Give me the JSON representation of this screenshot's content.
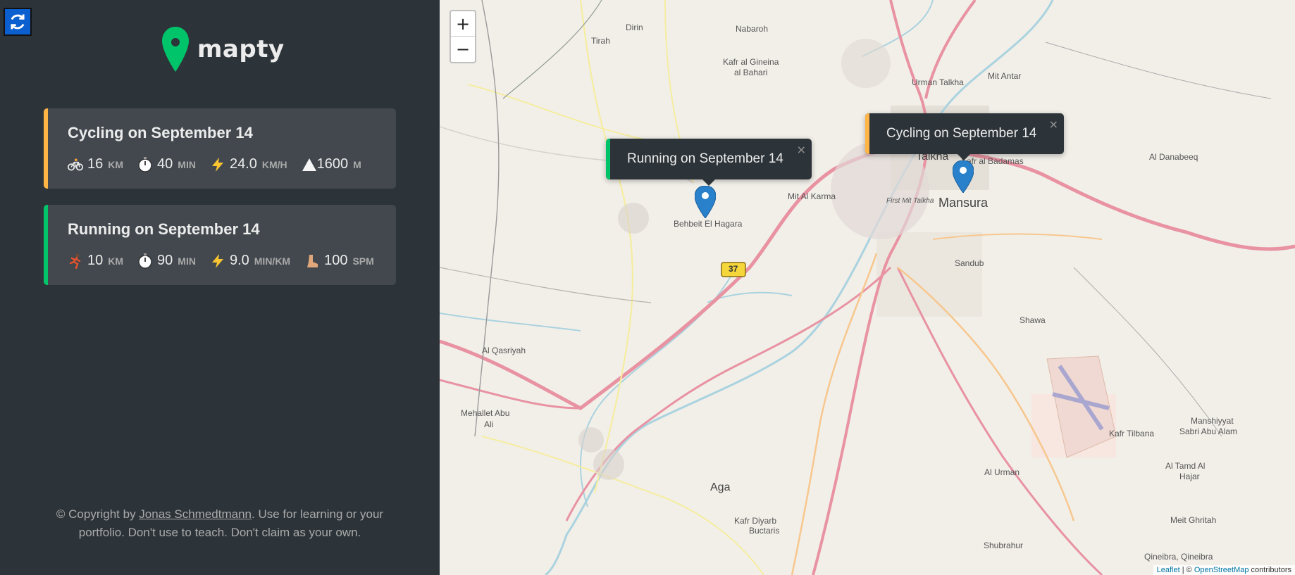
{
  "app": {
    "title": "mapty"
  },
  "colors": {
    "cycling": "#ffb545",
    "running": "#00c46a",
    "sidebar_bg": "#2d3439",
    "card_bg": "#42484d",
    "accent_button": "#0b5fcf"
  },
  "sidebar": {
    "reset_icon": "refresh-icon",
    "workouts": [
      {
        "type": "cycling",
        "title": "Cycling on September 14",
        "stats": [
          {
            "icon": "bicycle-icon",
            "value": "16",
            "unit": "km"
          },
          {
            "icon": "stopwatch-icon",
            "value": "40",
            "unit": "min"
          },
          {
            "icon": "lightning-icon",
            "value": "24.0",
            "unit": "km/h"
          },
          {
            "icon": "mountain-icon",
            "value": "1600",
            "unit": "m"
          }
        ]
      },
      {
        "type": "running",
        "title": "Running on September 14",
        "stats": [
          {
            "icon": "runner-icon",
            "value": "10",
            "unit": "km"
          },
          {
            "icon": "stopwatch-icon",
            "value": "90",
            "unit": "min"
          },
          {
            "icon": "lightning-icon",
            "value": "9.0",
            "unit": "min/km"
          },
          {
            "icon": "footprint-icon",
            "value": "100",
            "unit": "spm"
          }
        ]
      }
    ],
    "copyright": {
      "prefix": "© Copyright by ",
      "author": "Jonas Schmedtmann",
      "suffix": ". Use for learning or your portfolio. Don't use to teach. Don't claim as your own."
    }
  },
  "map": {
    "zoom_in": "+",
    "zoom_out": "−",
    "popups": [
      {
        "type": "running",
        "text": "Running on September 14",
        "close": "×"
      },
      {
        "type": "cycling",
        "text": "Cycling on September 14",
        "close": "×"
      }
    ],
    "labels": {
      "dirin": "Dirin",
      "nabaroh": "Nabaroh",
      "tirah": "Tirah",
      "kafr_ginena": "Kafr al Gineina",
      "kafr_ginena2": "al Bahari",
      "urman_talkha": "Urman Talkha",
      "mit_antar": "Mit Antar",
      "talkha": "Talkha",
      "kafr_badamas": "Kafr al Badamas",
      "mansura": "Mansura",
      "mit_karma": "Mit Al Karma",
      "behbeit": "Behbeit El Hagara",
      "first_mit_talkha": "First Mit Talkha",
      "sandub": "Sandub",
      "al_danabeeq": "Al Danabeeq",
      "shawa": "Shawa",
      "al_qasriyah": "Al Qasriyah",
      "mehallet": "Mehallet Abu",
      "mehallet2": "Ali",
      "aga": "Aga",
      "kafr_diyarb": "Kafr Diyarb",
      "buctaris": "Buctaris",
      "al_urman": "Al Urman",
      "kafr_tilbana": "Kafr Tilbana",
      "manshiyyat": "Manshiyyat",
      "sabri": "Sabri Abu Alam",
      "tamd": "Al Tamd Al",
      "hajar": "Hajar",
      "meit": "Meit Ghritah",
      "shubrahur": "Shubrahur",
      "qineibra": "Qineibra, Qineibra",
      "route_37": "37"
    },
    "attribution": {
      "leaflet": "Leaflet",
      "sep": " | © ",
      "osm": "OpenStreetMap",
      "contributors": " contributors"
    }
  }
}
